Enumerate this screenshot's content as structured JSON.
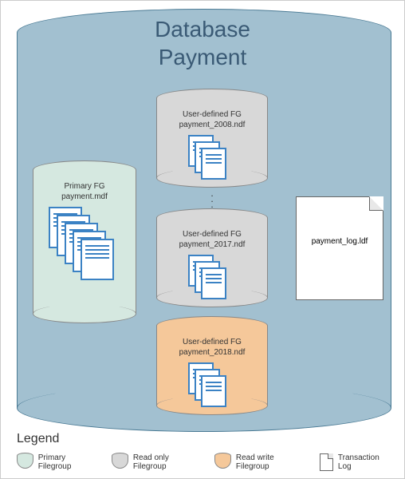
{
  "title_line1": "Database",
  "title_line2": "Payment",
  "primary": {
    "label_line1": "Primary FG",
    "label_line2": "payment.mdf"
  },
  "fg2008": {
    "label_line1": "User-defined FG",
    "label_line2": "payment_2008.ndf"
  },
  "fg2017": {
    "label_line1": "User-defined FG",
    "label_line2": "payment_2017.ndf"
  },
  "fg2018": {
    "label_line1": "User-defined FG",
    "label_line2": "payment_2018.ndf"
  },
  "log": {
    "label": "payment_log.ldf"
  },
  "legend": {
    "title": "Legend",
    "primary": "Primary Filegroup",
    "readonly": "Read only Filegroup",
    "readwrite": "Read write Filegroup",
    "tlog": "Transaction Log"
  },
  "colors": {
    "primary": "#d5e8e0",
    "readonly": "#d8d8d8",
    "readwrite": "#f5c89a"
  }
}
